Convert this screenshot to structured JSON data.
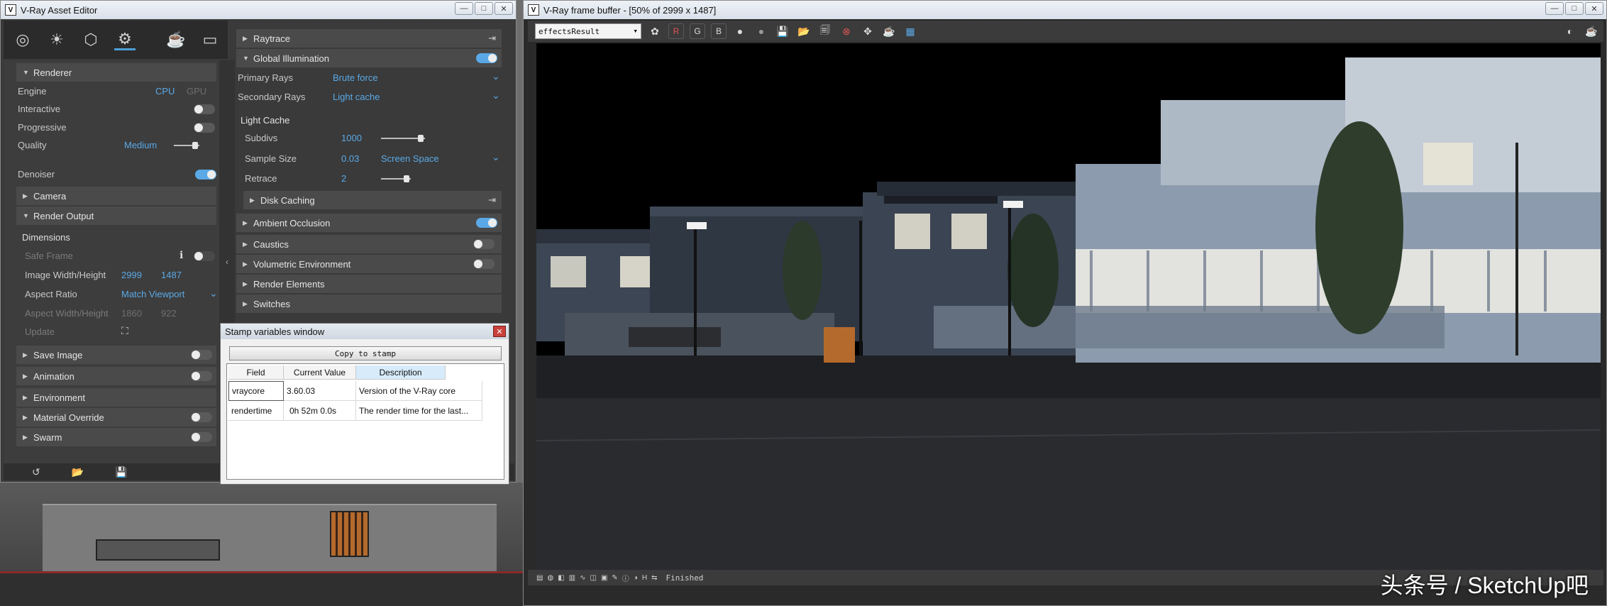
{
  "asset_editor": {
    "title": "V-Ray Asset Editor",
    "toolbar_icons": [
      "materials-icon",
      "lights-icon",
      "geometry-icon",
      "settings-icon",
      "render-teapot-icon",
      "frame-buffer-icon"
    ],
    "left": {
      "renderer_header": "Renderer",
      "engine_label": "Engine",
      "engine_cpu": "CPU",
      "engine_gpu": "GPU",
      "interactive_label": "Interactive",
      "progressive_label": "Progressive",
      "quality_label": "Quality",
      "quality_value": "Medium",
      "denoiser_label": "Denoiser",
      "camera_header": "Camera",
      "render_output_header": "Render Output",
      "dimensions_label": "Dimensions",
      "safe_frame_label": "Safe Frame",
      "image_wh_label": "Image Width/Height",
      "image_width": "2999",
      "image_height": "1487",
      "aspect_ratio_label": "Aspect Ratio",
      "aspect_ratio_value": "Match Viewport",
      "aspect_wh_label": "Aspect Width/Height",
      "aspect_width": "1860",
      "aspect_height": "922",
      "update_label": "Update",
      "save_image_header": "Save Image",
      "animation_header": "Animation",
      "environment_header": "Environment",
      "material_override_header": "Material Override",
      "swarm_header": "Swarm"
    },
    "right": {
      "raytrace_header": "Raytrace",
      "gi_header": "Global Illumination",
      "primary_rays_label": "Primary Rays",
      "primary_rays_value": "Brute force",
      "secondary_rays_label": "Secondary Rays",
      "secondary_rays_value": "Light cache",
      "light_cache_label": "Light Cache",
      "subdivs_label": "Subdivs",
      "subdivs_value": "1000",
      "sample_size_label": "Sample Size",
      "sample_size_value": "0.03",
      "sample_space_value": "Screen Space",
      "retrace_label": "Retrace",
      "retrace_value": "2",
      "disk_caching_header": "Disk Caching",
      "ambient_occlusion_header": "Ambient Occlusion",
      "caustics_header": "Caustics",
      "volumetric_header": "Volumetric Environment",
      "render_elements_header": "Render Elements",
      "switches_header": "Switches"
    }
  },
  "stamp_window": {
    "title": "Stamp variables window",
    "copy_button": "Copy to stamp",
    "columns": [
      "Field",
      "Current Value",
      "Description"
    ],
    "rows": [
      {
        "field": "vraycore",
        "value": "3.60.03",
        "description": "Version of the V-Ray core"
      },
      {
        "field": "rendertime",
        "value": "0h 52m  0.0s",
        "description": "The render time for the last..."
      }
    ]
  },
  "frame_buffer": {
    "title": "V-Ray frame buffer - [50% of 2999 x 1487]",
    "channel_select": "effectsResult",
    "channels": [
      "R",
      "G",
      "B"
    ],
    "status": "Finished"
  },
  "watermark": "头条号 / SketchUp吧",
  "colors": {
    "accent": "#5aa9e6",
    "panel": "#3d3d3d",
    "header": "#4a4a4a"
  }
}
